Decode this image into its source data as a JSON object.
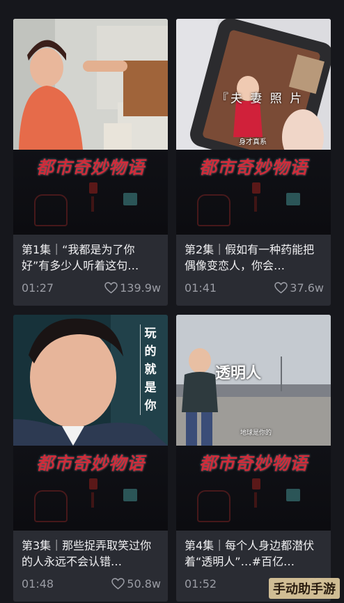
{
  "banner_text": "都市奇妙物语",
  "episodes": [
    {
      "title": "第1集｜“我都是为了你好”有多少人听着这句…",
      "duration": "01:27",
      "likes": "139.9w"
    },
    {
      "title": "第2集｜假如有一种药能把偶像变恋人，你会…",
      "duration": "01:41",
      "likes": "37.6w",
      "caption": "『夫 妻 照 片",
      "small_caption": "身才真系"
    },
    {
      "title": "第3集｜那些捉弄取笑过你的人永远不会认错…",
      "duration": "01:48",
      "likes": "50.8w",
      "caption": "玩的就是你"
    },
    {
      "title": "第4集｜每个人身边都潜伏着“透明人”…#百亿…",
      "duration": "01:52",
      "likes": "",
      "caption": "透明人",
      "small_caption": "地球是你的"
    }
  ],
  "watermark": "手动助手游",
  "colors": {
    "background": "#16171c",
    "card": "#2a2c33",
    "banner_red": "#cf2c3a",
    "meta_gray": "#9a9ca4"
  }
}
